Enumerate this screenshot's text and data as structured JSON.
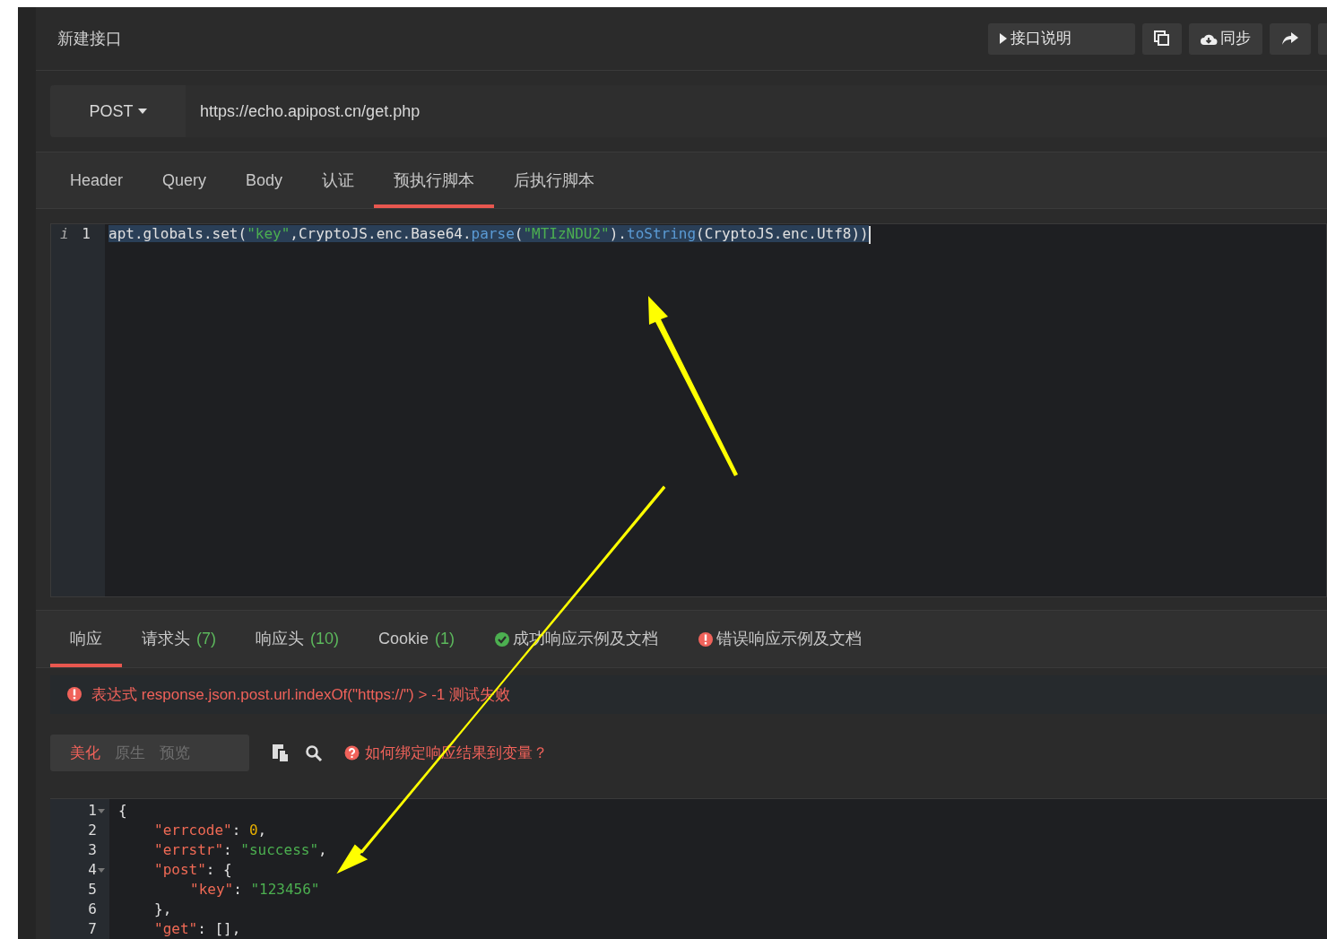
{
  "header": {
    "title": "新建接口",
    "buttons": [
      {
        "kind": "doc",
        "label": "接口说明"
      },
      {
        "kind": "copy"
      },
      {
        "kind": "sync",
        "label": "同步"
      },
      {
        "kind": "share"
      },
      {
        "kind": "partial"
      }
    ]
  },
  "request": {
    "method": "POST",
    "url": "https://echo.apipost.cn/get.php"
  },
  "request_tabs": [
    {
      "label": "Header",
      "selected": false
    },
    {
      "label": "Query",
      "selected": false
    },
    {
      "label": "Body",
      "selected": false
    },
    {
      "label": "认证",
      "selected": false
    },
    {
      "label": "预执行脚本",
      "selected": true
    },
    {
      "label": "后执行脚本",
      "selected": false
    }
  ],
  "script": {
    "lines": [
      {
        "number": "1",
        "marker": "i",
        "selected": true,
        "tokens": [
          {
            "kind": "plain",
            "t": "apt.globals.set("
          },
          {
            "kind": "str",
            "t": "\"key\""
          },
          {
            "kind": "plain",
            "t": ",CryptoJS.enc.Base64."
          },
          {
            "kind": "fn",
            "t": "parse"
          },
          {
            "kind": "plain",
            "t": "("
          },
          {
            "kind": "str",
            "t": "\"MTIzNDU2\""
          },
          {
            "kind": "plain",
            "t": ")."
          },
          {
            "kind": "fn",
            "t": "toString"
          },
          {
            "kind": "plain",
            "t": "(CryptoJS.enc.Utf8))"
          }
        ]
      }
    ]
  },
  "response_tabs": [
    {
      "kind": "tab",
      "label": "响应",
      "selected": true
    },
    {
      "kind": "tab",
      "label": "请求头",
      "count": "(7)",
      "selected": false
    },
    {
      "kind": "tab",
      "label": "响应头",
      "count": "(10)",
      "selected": false
    },
    {
      "kind": "tab",
      "label": "Cookie",
      "count": "(1)",
      "selected": false
    },
    {
      "kind": "success",
      "label": "成功响应示例及文档",
      "selected": false
    },
    {
      "kind": "error",
      "label": "错误响应示例及文档",
      "selected": false
    }
  ],
  "alert": {
    "text": "表达式 response.json.post.url.indexOf(\"https://\") > -1 测试失败"
  },
  "view_modes": [
    {
      "label": "美化",
      "selected": true
    },
    {
      "label": "原生",
      "selected": false
    },
    {
      "label": "预览",
      "selected": false
    }
  ],
  "help_link": "如何绑定响应结果到变量？",
  "response_body": {
    "lines": [
      {
        "number": "1",
        "foldable": true,
        "tokens": [
          {
            "kind": "punc",
            "t": "{"
          }
        ],
        "children": [
          {
            "number": "2",
            "foldable": false,
            "tokens": [
              {
                "kind": "key",
                "t": "\"errcode\""
              },
              {
                "kind": "punc",
                "t": ": "
              },
              {
                "kind": "num",
                "t": "0"
              },
              {
                "kind": "punc",
                "t": ","
              }
            ]
          },
          {
            "number": "3",
            "foldable": false,
            "tokens": [
              {
                "kind": "key",
                "t": "\"errstr\""
              },
              {
                "kind": "punc",
                "t": ": "
              },
              {
                "kind": "str",
                "t": "\"success\""
              },
              {
                "kind": "punc",
                "t": ","
              }
            ]
          },
          {
            "number": "4",
            "foldable": true,
            "tokens": [
              {
                "kind": "key",
                "t": "\"post\""
              },
              {
                "kind": "punc",
                "t": ": {"
              }
            ],
            "children": [
              {
                "number": "5",
                "foldable": false,
                "tokens": [
                  {
                    "kind": "key",
                    "t": "\"key\""
                  },
                  {
                    "kind": "punc",
                    "t": ": "
                  },
                  {
                    "kind": "str",
                    "t": "\"123456\""
                  }
                ]
              }
            ]
          },
          {
            "number": "6",
            "foldable": false,
            "tokens": [
              {
                "kind": "punc",
                "t": "},"
              }
            ]
          },
          {
            "number": "7",
            "foldable": false,
            "tokens": [
              {
                "kind": "key",
                "t": "\"get\""
              },
              {
                "kind": "punc",
                "t": ": [],"
              }
            ]
          }
        ]
      }
    ]
  }
}
